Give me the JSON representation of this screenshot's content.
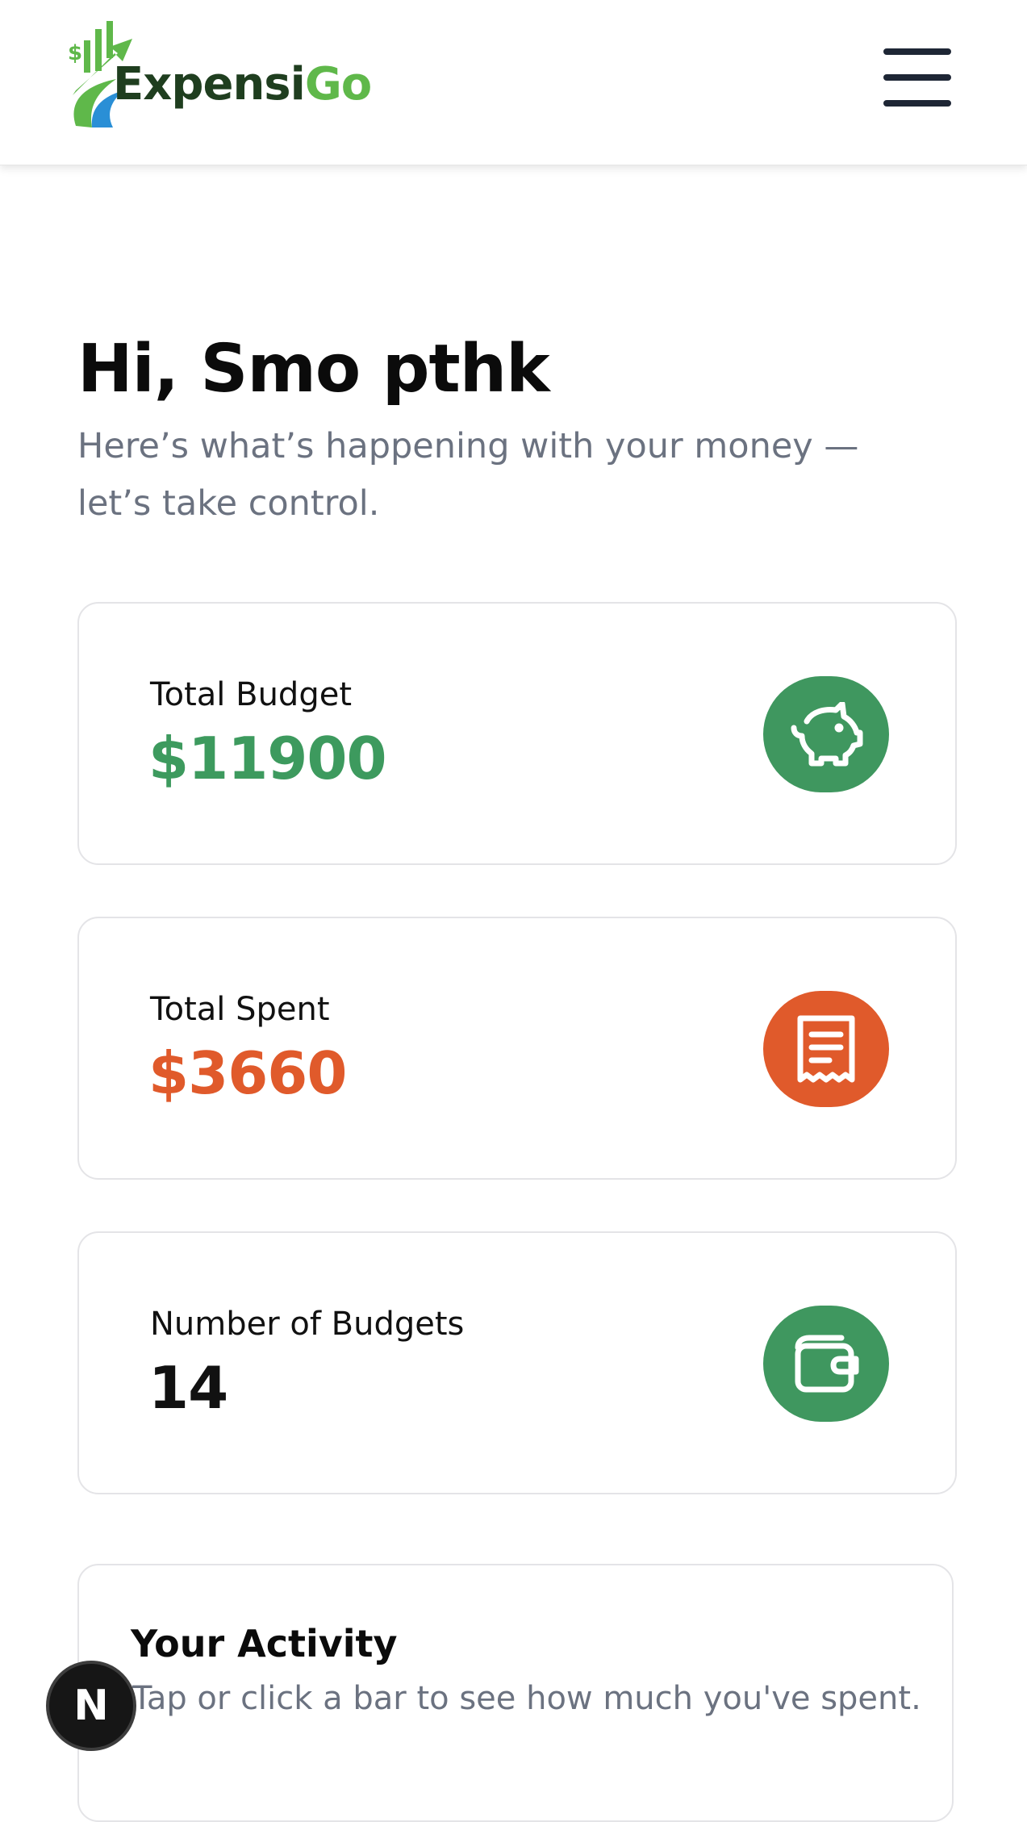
{
  "header": {
    "brand_part1": "Expensi",
    "brand_part2": "Go",
    "menu_icon": "hamburger-menu-icon"
  },
  "hero": {
    "greeting": "Hi, Smo pthk",
    "subtitle": "Here’s what’s happening with your money — let’s take control."
  },
  "stats": [
    {
      "label": "Total Budget",
      "value": "$11900",
      "icon": "piggy-bank-icon",
      "value_color": "#3d9a5e",
      "icon_bg": "#3f975f"
    },
    {
      "label": "Total Spent",
      "value": "$3660",
      "icon": "receipt-icon",
      "value_color": "#e05a2b",
      "icon_bg": "#e05a2b"
    },
    {
      "label": "Number of Budgets",
      "value": "14",
      "icon": "wallet-icon",
      "value_color": "#111111",
      "icon_bg": "#3f975f"
    }
  ],
  "activity": {
    "title": "Your Activity",
    "subtitle": "Tap or click a bar to see how much you've spent."
  },
  "dev_badge": {
    "letter": "N"
  },
  "colors": {
    "brand_dark": "#1f3e1f",
    "brand_green": "#5fb84a",
    "accent_green": "#3f975f",
    "accent_orange": "#e05a2b"
  }
}
